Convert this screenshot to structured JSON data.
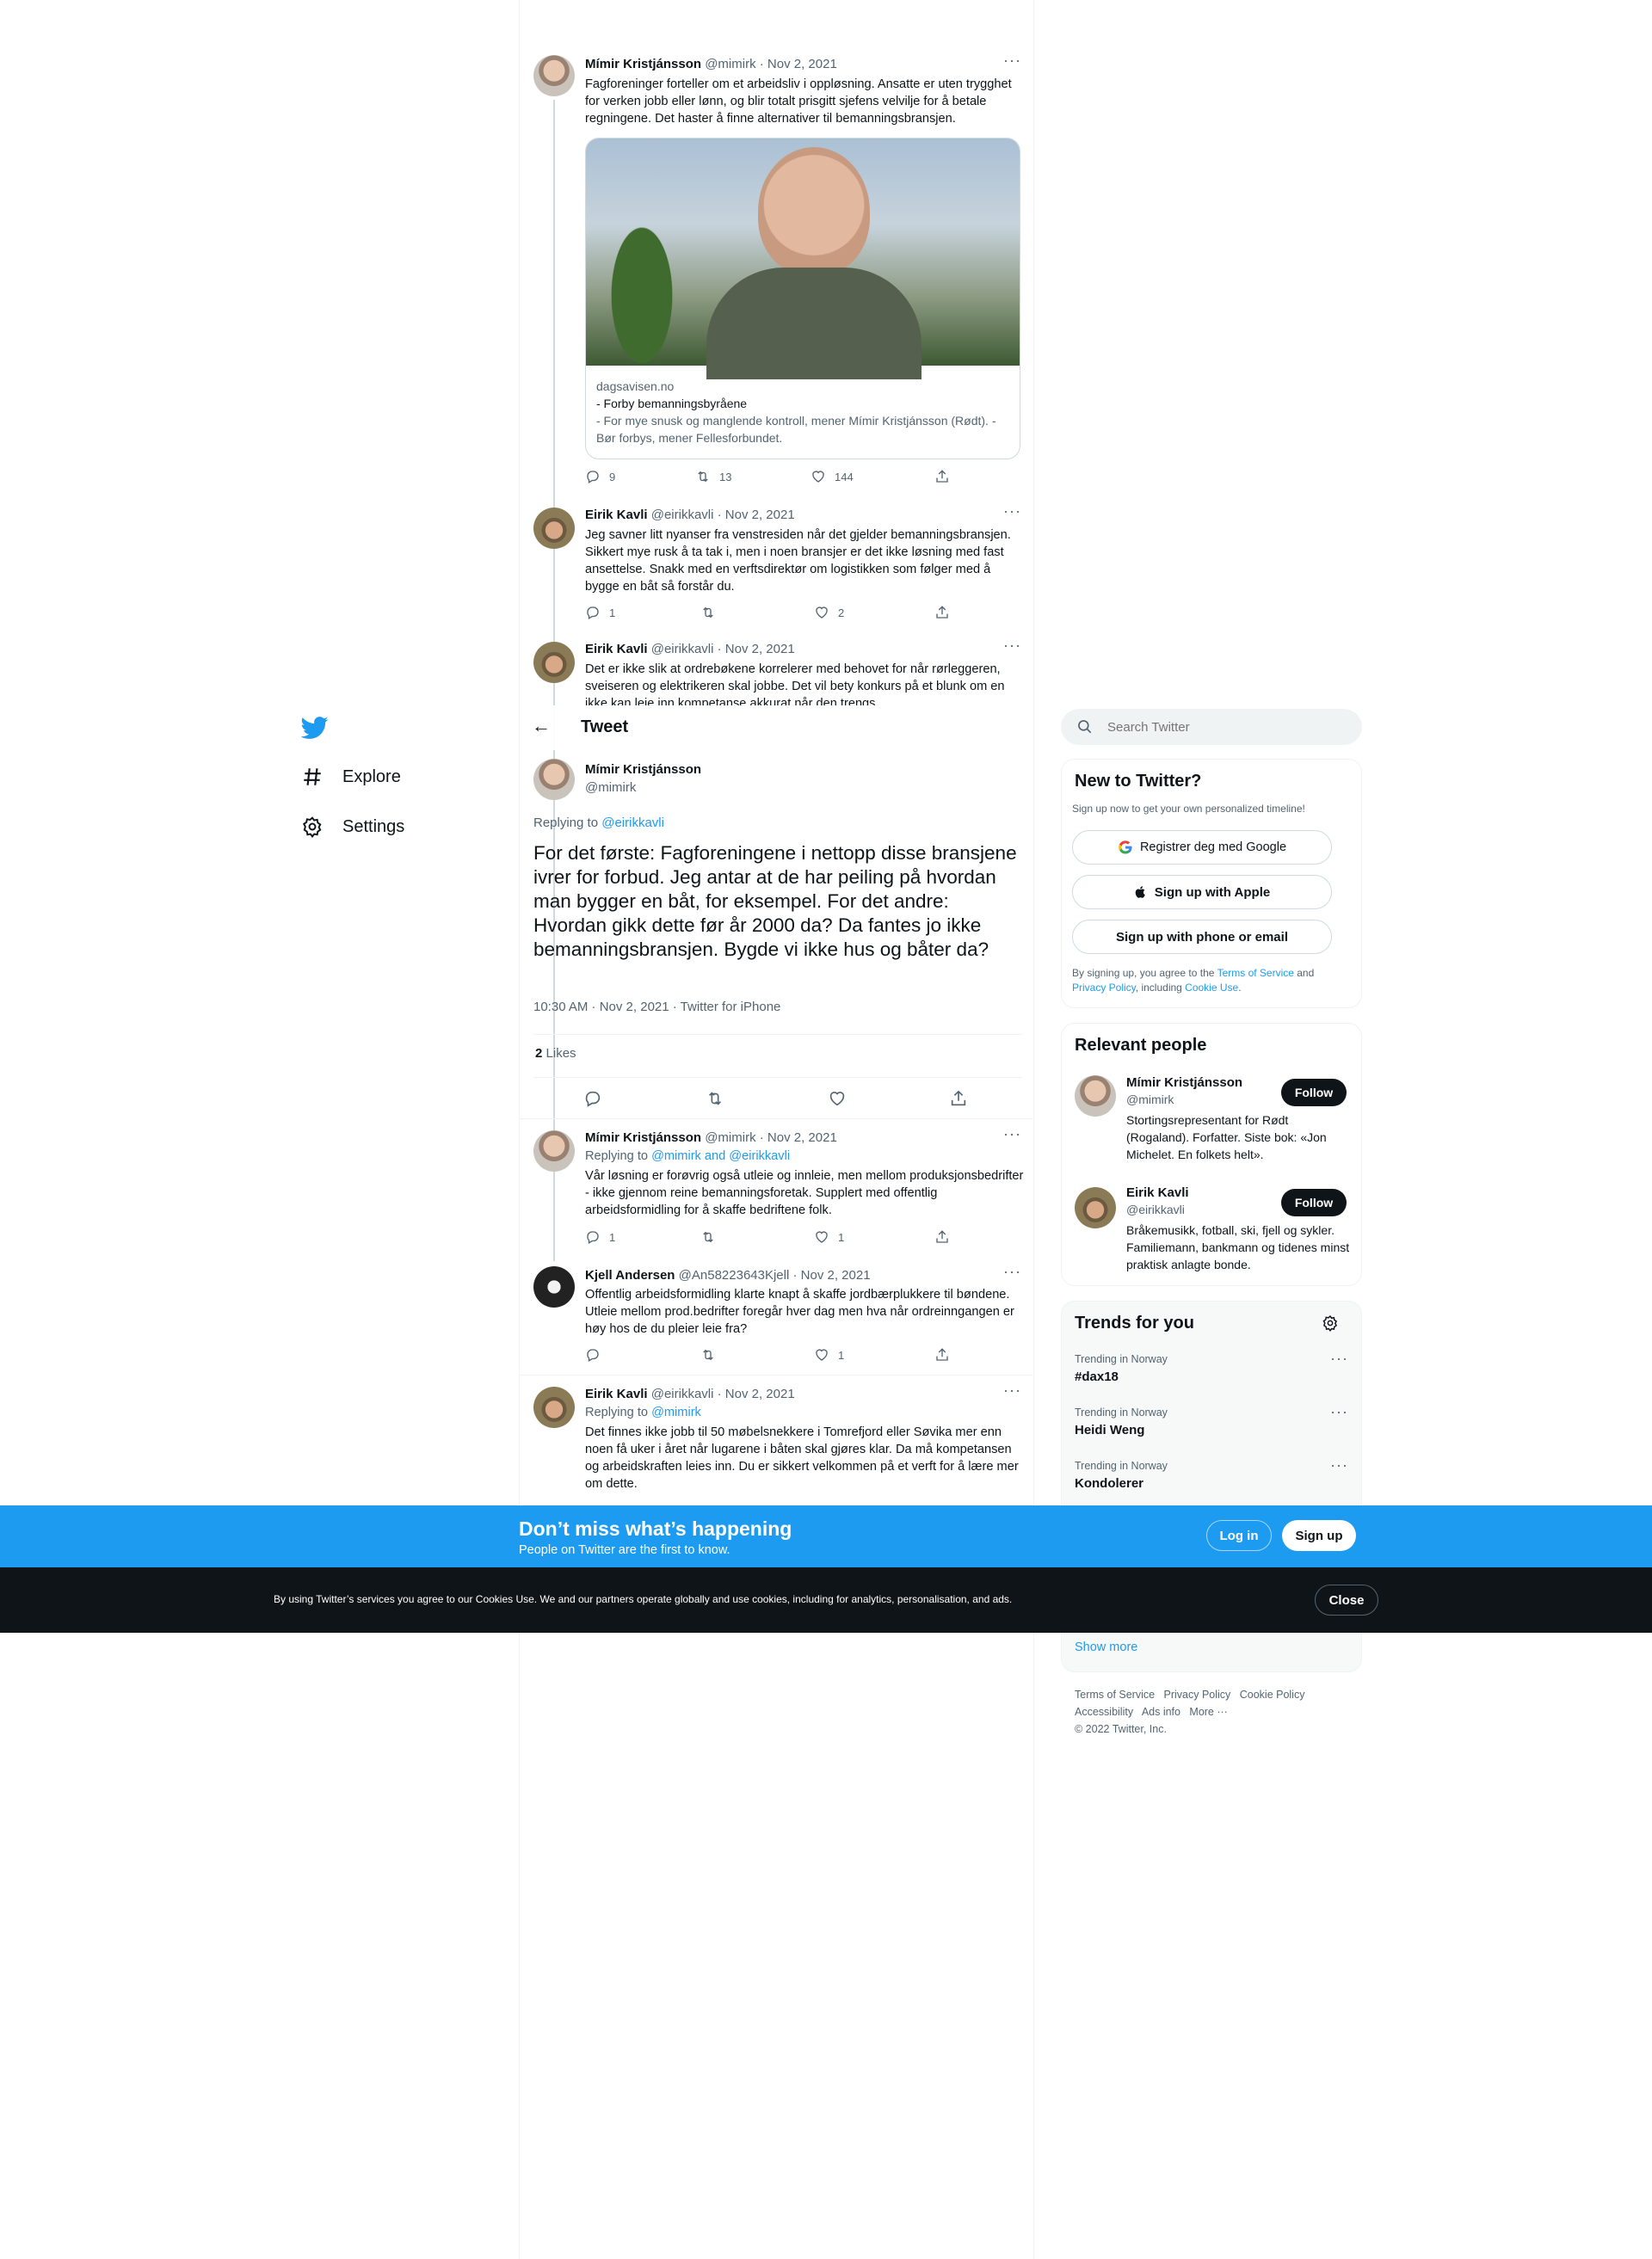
{
  "nav": {
    "explore_label": "Explore",
    "settings_label": "Settings"
  },
  "thread": {
    "t1": {
      "name": "Mímir Kristjánsson",
      "meta": "@mimirk · Nov 2, 2021",
      "text": "Fagforeninger forteller om et arbeidsliv i oppløsning. Ansatte er uten trygghet for verken jobb eller lønn, og blir totalt prisgitt sjefens velvilje for å betale regningene. Det haster å finne alternativer til bemanningsbransjen.",
      "link_domain": "dagsavisen.no",
      "link_title": "- Forby bemanningsbyråene",
      "link_desc": "- For mye snusk og manglende kontroll, mener Mímir Kristjánsson (Rødt). - Bør forbys, mener Fellesforbundet.",
      "replies": "9",
      "retweets": "13",
      "likes": "144"
    },
    "t2": {
      "name": "Eirik Kavli",
      "meta": "@eirikkavli · Nov 2, 2021",
      "text": "Jeg savner litt nyanser fra venstresiden når det gjelder bemanningsbransjen. Sikkert mye rusk å ta tak i, men i noen bransjer er det ikke løsning med fast ansettelse. Snakk med en verftsdirektør om logistikken som følger med å bygge en båt så forstår du.",
      "replies": "1",
      "retweets": "",
      "likes": "2"
    },
    "t3": {
      "name": "Eirik Kavli",
      "meta": "@eirikkavli · Nov 2, 2021",
      "text": "Det er ikke slik at ordrebøkene korrelerer med behovet for når rørleggeren, sveiseren og elektrikeren skal jobbe. Det vil bety konkurs på et blunk om en ikke kan leie inn kompetanse akkurat når den trengs."
    }
  },
  "header": {
    "title": "Tweet",
    "back_label": "←"
  },
  "main_tweet": {
    "name": "Mímir Kristjánsson",
    "handle": "@mimirk",
    "replying_prefix": "Replying to ",
    "replying_to": "@eirikkavli",
    "text": "For det første: Fagforeningene i nettopp disse bransjene ivrer for forbud. Jeg antar at de har peiling på hvordan man bygger en båt, for eksempel. For det andre: Hvordan gikk dette før år 2000 da? Da fantes jo ikke bemanningsbransjen. Bygde vi ikke hus og båter da?",
    "timestamp": "10:30 AM · Nov 2, 2021 · Twitter for iPhone",
    "likes_count": "2",
    "likes_label": "Likes"
  },
  "replies": [
    {
      "name": "Mímir Kristjánsson",
      "meta": "@mimirk · Nov 2, 2021",
      "replying_prefix": "Replying to ",
      "replying_to": "@mimirk and @eirikkavli",
      "text": "Vår løsning er forøvrig også utleie og innleie, men mellom produksjonsbedrifter - ikke gjennom reine bemanningsforetak. Supplert med offentlig arbeidsformidling for å skaffe bedriftene folk.",
      "replies": "1",
      "retweets": "",
      "likes": "1"
    },
    {
      "name": "Kjell Andersen",
      "meta": "@An58223643Kjell · Nov 2, 2021",
      "text": "Offentlig arbeidsformidling klarte knapt å skaffe jordbærplukkere til bøndene. Utleie mellom prod.bedrifter foregår hver dag men hva når ordreinngangen er høy hos de du pleier leie fra?",
      "replies": "",
      "retweets": "",
      "likes": "1"
    },
    {
      "name": "Eirik Kavli",
      "meta": "@eirikkavli · Nov 2, 2021",
      "replying_prefix": "Replying to ",
      "replying_to": "@mimirk",
      "text": "Det finnes ikke jobb til 50 møbelsnekkere i Tomrefjord eller Søvika mer enn noen få uker i året når lugarene i båten skal gjøres klar. Da må kompetansen og arbeidskraften leies inn. Du er sikkert velkommen på et verft for å lære mer om dette."
    }
  ],
  "search": {
    "placeholder": "Search Twitter"
  },
  "signup": {
    "title": "New to Twitter?",
    "subtitle": "Sign up now to get your own personalized timeline!",
    "google_label": "Registrer deg med Google",
    "apple_label": "Sign up with Apple",
    "email_label": "Sign up with phone or email",
    "terms_prefix": "By signing up, you agree to the ",
    "terms_link": "Terms of Service",
    "terms_and": " and ",
    "privacy_link": "Privacy Policy",
    "terms_including": ", including ",
    "cookie_link": "Cookie Use",
    "terms_end": "."
  },
  "relevant": {
    "title": "Relevant people",
    "people": [
      {
        "name": "Mímir Kristjánsson",
        "handle": "@mimirk",
        "bio": "Stortingsrepresentant for Rødt (Rogaland). Forfatter. Siste bok: «Jon Michelet. En folkets helt».",
        "follow_label": "Follow"
      },
      {
        "name": "Eirik Kavli",
        "handle": "@eirikkavli",
        "bio": "Bråkemusikk, fotball, ski, fjell og sykler. Familiemann, bankmann og tidenes minst praktisk anlagte bonde.",
        "follow_label": "Follow"
      }
    ]
  },
  "trends": {
    "title": "Trends for you",
    "items": [
      {
        "context": "Trending in Norway",
        "name": "#dax18"
      },
      {
        "context": "Trending in Norway",
        "name": "Heidi Weng"
      },
      {
        "context": "Trending in Norway",
        "name": "Kondolerer"
      }
    ],
    "show_more": "Show more"
  },
  "footer": {
    "links_row1": [
      "Terms of Service",
      "Privacy Policy",
      "Cookie Policy"
    ],
    "links_row2": [
      "Accessibility",
      "Ads info",
      "More ···"
    ],
    "copyright": "© 2022 Twitter, Inc."
  },
  "banner": {
    "title": "Don’t miss what’s happening",
    "subtitle": "People on Twitter are the first to know.",
    "login_label": "Log in",
    "signup_label": "Sign up"
  },
  "cookie": {
    "text": "By using Twitter’s services you agree to our Cookies Use. We and our partners operate globally and use cookies, including for analytics, personalisation, and ads.",
    "close_label": "Close"
  },
  "colors": {
    "brand_blue": "#1d9bf0",
    "text_primary": "#0f1419",
    "text_secondary": "#536471",
    "cookie_bar": "#0f1419"
  }
}
